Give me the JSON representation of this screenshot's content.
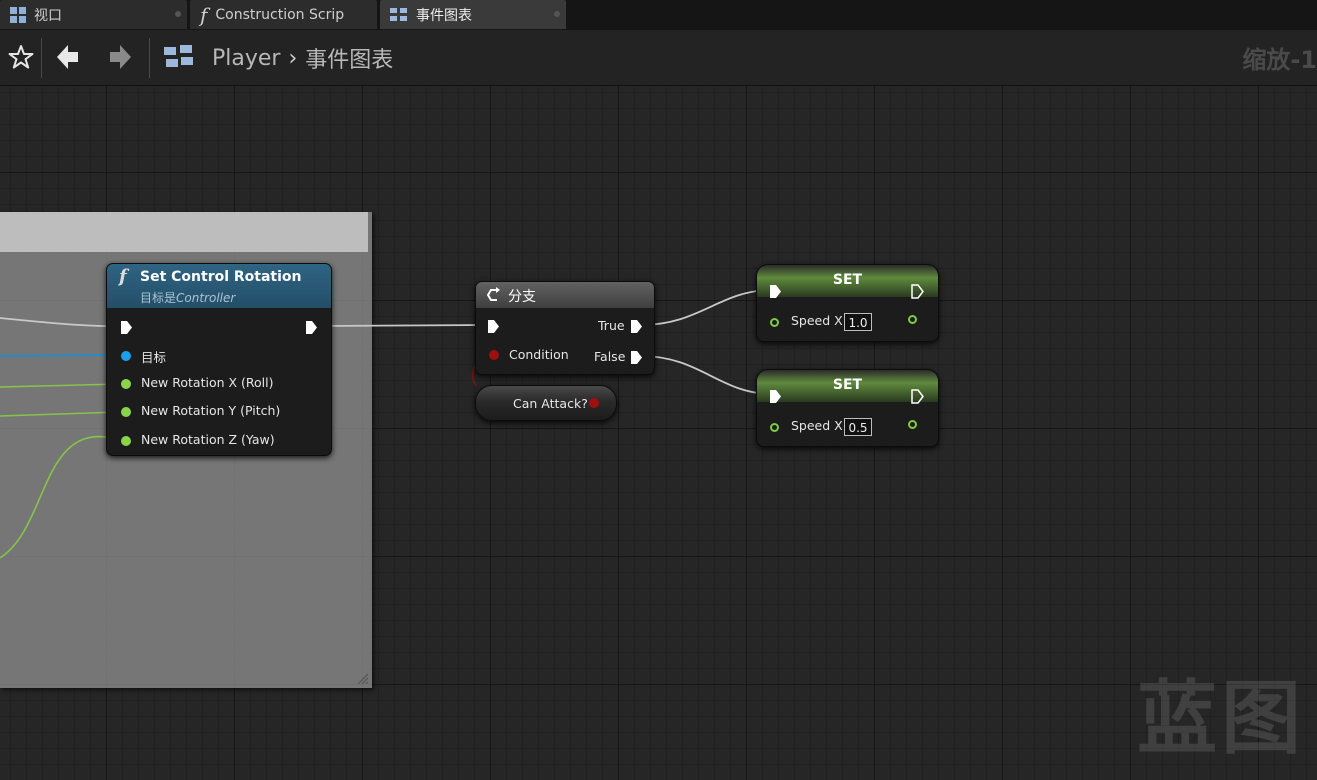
{
  "tabs": [
    {
      "label": "视口",
      "icon": "viewport-grid-icon"
    },
    {
      "label": "Construction Scrip",
      "icon": "function-icon"
    },
    {
      "label": "事件图表",
      "icon": "event-graph-icon",
      "active": true
    }
  ],
  "toolbar": {
    "breadcrumb": [
      "Player",
      "事件图表"
    ],
    "zoom": "缩放-1"
  },
  "graph": {
    "watermark": "蓝图",
    "nodes": {
      "set_control_rotation": {
        "title": "Set Control Rotation",
        "subtitle_prefix": "目标是",
        "subtitle_target": "Controller",
        "pins": [
          "目标",
          "New Rotation X (Roll)",
          "New Rotation Y (Pitch)",
          "New Rotation Z (Yaw)"
        ]
      },
      "branch": {
        "title": "分支",
        "condition": "Condition",
        "true_label": "True",
        "false_label": "False"
      },
      "can_attack": {
        "label": "Can Attack?"
      },
      "set1": {
        "title": "SET",
        "var": "Speed X",
        "value": "1.0"
      },
      "set2": {
        "title": "SET",
        "var": "Speed X",
        "value": "0.5"
      }
    }
  },
  "colors": {
    "exec": "#ffffff",
    "float_pin": "#8ad44a",
    "object_pin": "#19a0ec",
    "bool_pin": "#a00f0f",
    "function_header": "#2c5a78",
    "set_header": "#4d6e34"
  }
}
